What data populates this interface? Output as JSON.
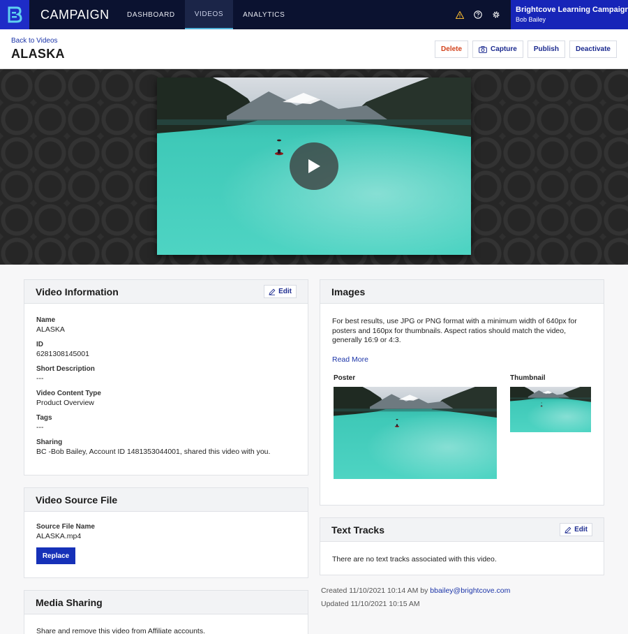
{
  "nav": {
    "app_name": "CAMPAIGN",
    "items": [
      {
        "label": "DASHBOARD"
      },
      {
        "label": "VIDEOS"
      },
      {
        "label": "ANALYTICS"
      }
    ],
    "icons": [
      "warning-icon",
      "help-icon",
      "gear-icon"
    ],
    "account_name": "Brightcove Learning Campaign",
    "user_name": "Bob Bailey"
  },
  "header": {
    "back_label": "Back to Videos",
    "title": "ALASKA",
    "actions": {
      "delete": "Delete",
      "capture": "Capture",
      "publish": "Publish",
      "deactivate": "Deactivate"
    }
  },
  "video_info": {
    "heading": "Video Information",
    "edit_label": "Edit",
    "fields": [
      {
        "label": "Name",
        "value": "ALASKA"
      },
      {
        "label": "ID",
        "value": "6281308145001"
      },
      {
        "label": "Short Description",
        "value": "---"
      },
      {
        "label": "Video Content Type",
        "value": "Product Overview"
      },
      {
        "label": "Tags",
        "value": "---"
      },
      {
        "label": "Sharing",
        "value": "BC -Bob Bailey, Account ID 1481353044001, shared this video with you."
      }
    ]
  },
  "source_file": {
    "heading": "Video Source File",
    "label": "Source File Name",
    "value": "ALASKA.mp4",
    "replace_label": "Replace"
  },
  "media_sharing": {
    "heading": "Media Sharing",
    "text": "Share and remove this video from Affiliate accounts."
  },
  "images": {
    "heading": "Images",
    "description": "For best results, use JPG or PNG format with a minimum width of 640px for posters and 160px for thumbnails. Aspect ratios should match the video, generally 16:9 or 4:3.",
    "read_more": "Read More",
    "poster_label": "Poster",
    "thumbnail_label": "Thumbnail"
  },
  "text_tracks": {
    "heading": "Text Tracks",
    "edit_label": "Edit",
    "empty_text": "There are no text tracks associated with this video."
  },
  "meta": {
    "created_prefix": "Created 11/10/2021 10:14 AM by",
    "created_by": "bbailey@brightcove.com",
    "updated": "Updated 11/10/2021 10:15 AM"
  },
  "colors": {
    "nav_bg": "#0b1230",
    "brand_blue": "#1725b8",
    "link": "#1b34a8",
    "danger": "#d2421c",
    "lake": "#3fc9b8"
  }
}
